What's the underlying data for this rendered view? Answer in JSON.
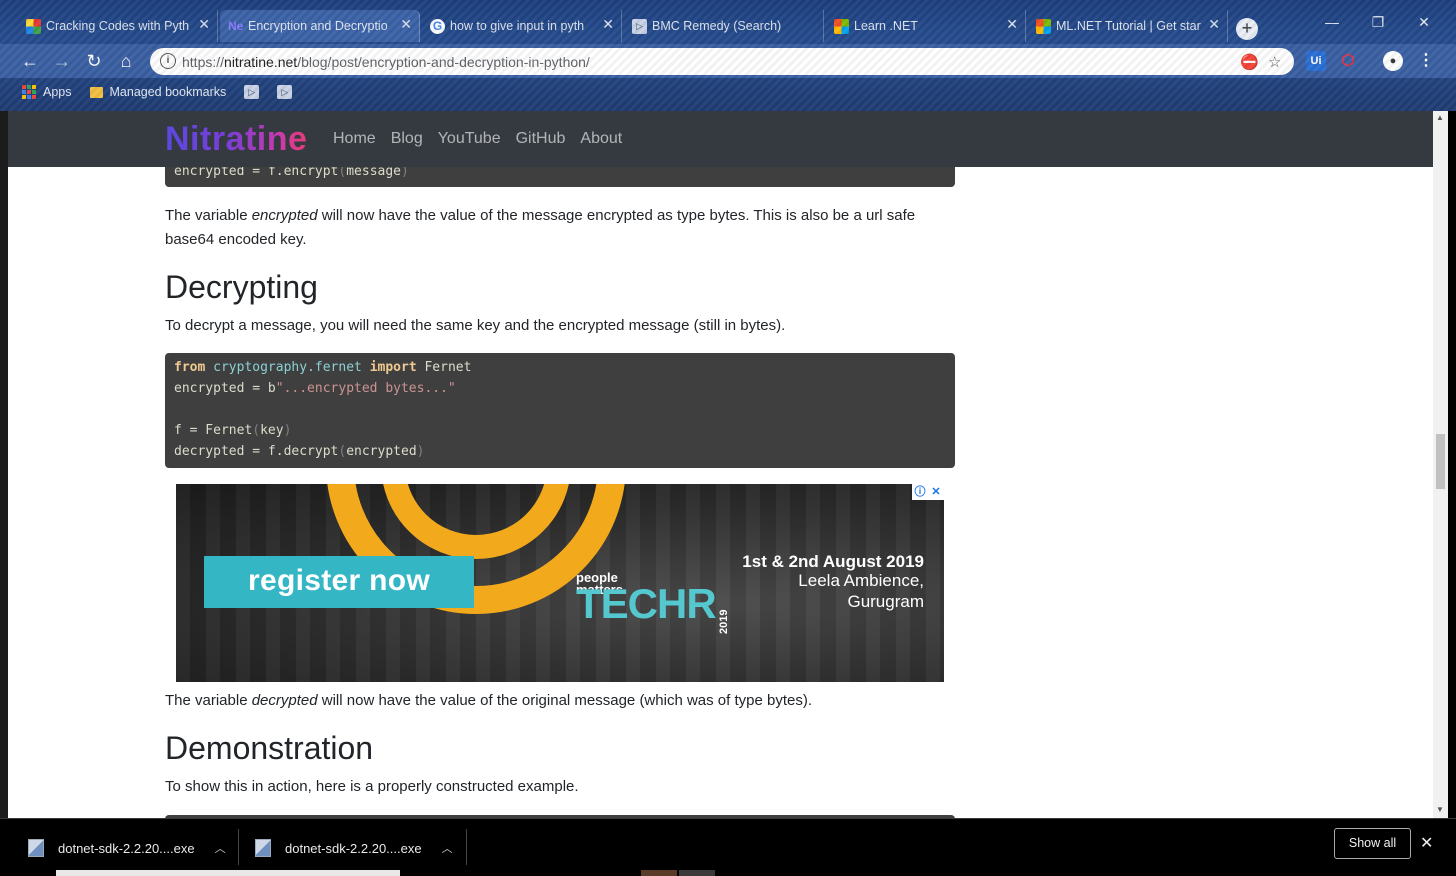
{
  "tabs": [
    {
      "title": "Cracking Codes with Pyth",
      "active": false
    },
    {
      "title": "Encryption and Decryptio",
      "active": true
    },
    {
      "title": "how to give input in pyth",
      "active": false
    },
    {
      "title": "BMC Remedy (Search)",
      "active": false
    },
    {
      "title": "Learn .NET",
      "active": false
    },
    {
      "title": "ML.NET Tutorial | Get star",
      "active": false
    }
  ],
  "omnibox": {
    "url_scheme": "https://",
    "url_host": "nitratine.net",
    "url_path": "/blog/post/encryption-and-decryption-in-python/"
  },
  "bookmarks": {
    "apps": "Apps",
    "managed": "Managed bookmarks"
  },
  "site": {
    "brand": "Nitratine",
    "nav": [
      "Home",
      "Blog",
      "YouTube",
      "GitHub",
      "About"
    ]
  },
  "article": {
    "code1_tail": {
      "var": "encrypted",
      "eq": " = ",
      "call": "f.encrypt",
      "arg": "message"
    },
    "p1_before": "The variable ",
    "p1_em": "encrypted",
    "p1_after": " will now have the value of the message encrypted as type bytes. This is also be a url safe base64 encoded key.",
    "h_decrypting": "Decrypting",
    "p2": "To decrypt a message, you will need the same key and the encrypted message (still in bytes).",
    "code2": {
      "l1_from": "from",
      "l1_mod": "cryptography.fernet",
      "l1_import": "import",
      "l1_name": "Fernet",
      "l2_var": "encrypted = b",
      "l2_str": "\"...encrypted bytes...\"",
      "l4_lhs": "f = Fernet",
      "l4_arg": "key",
      "l5_lhs": "decrypted = f.decrypt",
      "l5_arg": "encrypted"
    },
    "p3_before": "The variable ",
    "p3_em": "decrypted",
    "p3_after": " will now have the value of the original message (which was of type bytes).",
    "h_demo": "Demonstration",
    "p4": "To show this in action, here is a properly constructed example."
  },
  "ad": {
    "cta": "register now",
    "brand_small": "people matters",
    "brand_big": "TECHR",
    "year": "2019",
    "date": "1st & 2nd August 2019",
    "venue_line1": "Leela Ambience,",
    "venue_line2": "Gurugram"
  },
  "downloads": [
    {
      "name": "dotnet-sdk-2.2.20....exe"
    },
    {
      "name": "dotnet-sdk-2.2.20....exe"
    }
  ],
  "shelf": {
    "show_all": "Show all"
  },
  "colors": {
    "nav_bg": "#343a40",
    "code_bg": "#3f3f3f",
    "accent_teal": "#34b6c4",
    "accent_orange": "#f2a91c"
  }
}
